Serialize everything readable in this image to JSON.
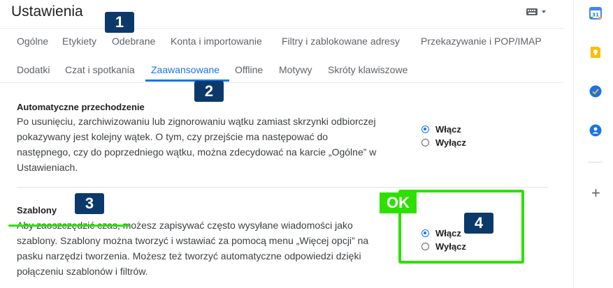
{
  "header": {
    "title": "Ustawienia"
  },
  "tabs": [
    {
      "label": "Ogólne"
    },
    {
      "label": "Etykiety"
    },
    {
      "label": "Odebrane"
    },
    {
      "label": "Konta i importowanie"
    },
    {
      "label": "Filtry i zablokowane adresy"
    },
    {
      "label": "Przekazywanie i POP/IMAP"
    },
    {
      "label": "Dodatki"
    },
    {
      "label": "Czat i spotkania"
    },
    {
      "label": "Zaawansowane"
    },
    {
      "label": "Offline"
    },
    {
      "label": "Motywy"
    },
    {
      "label": "Skróty klawiszowe"
    }
  ],
  "sections": {
    "auto": {
      "title": "Automatyczne przechodzenie",
      "desc": "Po usunięciu, zarchiwizowaniu lub zignorowaniu wątku zamiast skrzynki odbiorczej pokazywany jest kolejny wątek. O tym, czy przejście ma następować do następnego, czy do poprzedniego wątku, można zdecydować na karcie „Ogólne” w Ustawieniach.",
      "on": "Włącz",
      "off": "Wyłącz"
    },
    "templates": {
      "title": "Szablony",
      "desc": "Aby zaoszczędzić czas, możesz zapisywać często wysyłane wiadomości jako szablony. Szablony można tworzyć i wstawiać za pomocą menu „Więcej opcji” na pasku narzędzi tworzenia. Możesz też tworzyć automatyczne odpowiedzi dzięki połączeniu szablonów i filtrów.",
      "on": "Włącz",
      "off": "Wyłącz"
    }
  },
  "annotations": {
    "badge1": "1",
    "badge2": "2",
    "badge3": "3",
    "badge4": "4",
    "ok": "OK"
  },
  "colors": {
    "accent": "#1a73e8",
    "annotation_bg": "#0b3a6a",
    "highlight": "#2ee000"
  }
}
